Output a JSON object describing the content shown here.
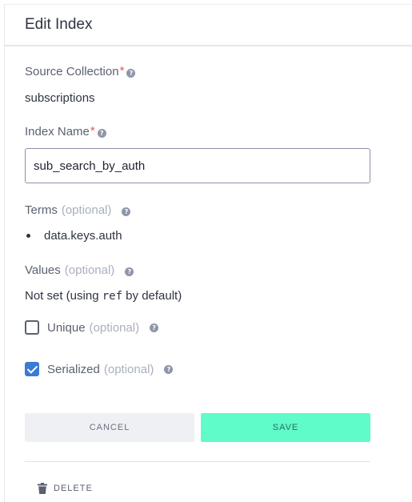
{
  "dialog": {
    "title": "Edit Index"
  },
  "source_collection": {
    "label": "Source Collection",
    "required_mark": "*",
    "value": "subscriptions"
  },
  "index_name": {
    "label": "Index Name",
    "required_mark": "*",
    "value": "sub_search_by_auth"
  },
  "terms": {
    "label": "Terms",
    "optional": "(optional)",
    "items": [
      "data.keys.auth"
    ]
  },
  "values": {
    "label": "Values",
    "optional": "(optional)",
    "text_before": "Not set (using ",
    "code": "ref",
    "text_after": " by default)"
  },
  "unique": {
    "label": "Unique",
    "optional": "(optional)",
    "checked": false
  },
  "serialized": {
    "label": "Serialized",
    "optional": "(optional)",
    "checked": true
  },
  "actions": {
    "cancel_label": "CANCEL",
    "save_label": "SAVE",
    "delete_label": "DELETE"
  },
  "icons": {
    "help": "question-circle-icon",
    "delete": "trash-icon"
  },
  "colors": {
    "save_bg": "#5ffbc8",
    "required": "#e0595d",
    "checkbox_checked": "#3a7bd5"
  }
}
